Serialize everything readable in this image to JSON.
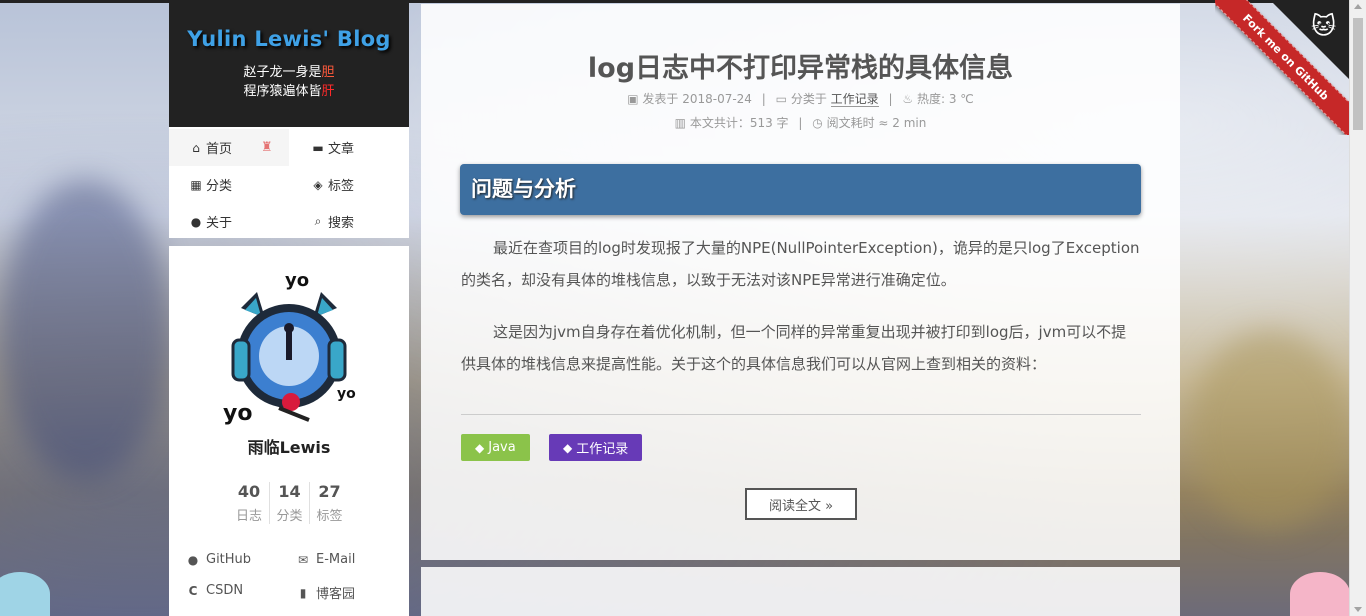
{
  "brand": {
    "title": "Yulin Lewis' Blog",
    "subtitle_line1_a": "赵子龙一身是",
    "subtitle_line1_b": "胆",
    "subtitle_line2_a": "程序猿遍体皆",
    "subtitle_line2_b": "肝"
  },
  "menu": {
    "home": "首页",
    "archive": "文章",
    "categories": "分类",
    "tags": "标签",
    "about": "关于",
    "search": "搜索"
  },
  "profile": {
    "author": "雨临Lewis",
    "stats": [
      {
        "num": "40",
        "label": "日志"
      },
      {
        "num": "14",
        "label": "分类"
      },
      {
        "num": "27",
        "label": "标签"
      }
    ],
    "links": {
      "github": "GitHub",
      "email": "E-Mail",
      "csdn": "CSDN",
      "cnblogs": "博客园"
    }
  },
  "post": {
    "title": "log日志中不打印异常栈的具体信息",
    "posted_label": "发表于",
    "posted_date": "2018-07-24",
    "category_label": "分类于",
    "category": "工作记录",
    "heat_label": "热度:",
    "heat_value": "3 ℃",
    "wordcount": "本文共计：513 字",
    "readtime": "阅文耗时 ≈ 2 min",
    "section_heading": "问题与分析",
    "paragraph1": "最近在查项目的log时发现报了大量的NPE(NullPointerException)，诡异的是只log了Exception的类名，却没有具体的堆栈信息，以致于无法对该NPE异常进行准确定位。",
    "paragraph2": "这是因为jvm自身存在着优化机制，但一个同样的异常重复出现并被打印到log后，jvm可以不提供具体的堆栈信息来提高性能。关于这个的具体信息我们可以从官网上查到相关的资料：",
    "tags": [
      "Java",
      "工作记录"
    ],
    "read_more": "阅读全文 »"
  },
  "ribbon": {
    "text": "Fork me on GitHub"
  },
  "colors": {
    "accent_blue": "#3d6fa0",
    "tag_java": "#8bc34a",
    "tag_work": "#673ab7",
    "ribbon_red": "#c62828"
  }
}
